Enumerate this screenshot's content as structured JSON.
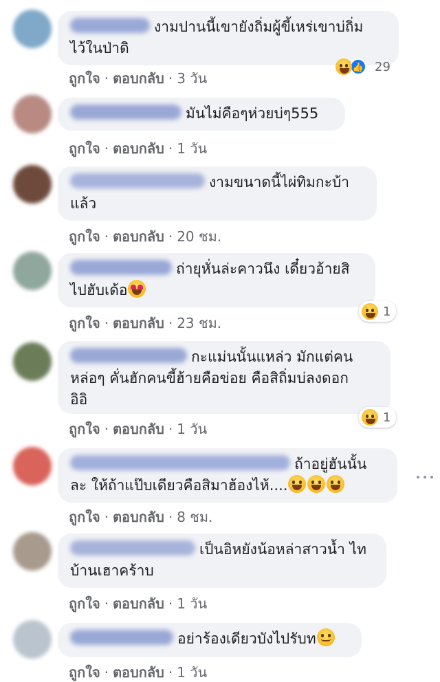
{
  "actions": {
    "like": "ถูกใจ",
    "reply": "ตอบกลับ",
    "sep": "·"
  },
  "comments": [
    {
      "text": "งามปานนี้เขายังถิ่มผู้ขี้เหร่เขาบ่ถิ่ม\nไว้ในป่าดิ",
      "time": "3 วัน",
      "reaction_count": "29",
      "avatar_color": "#7fa8c9"
    },
    {
      "text": "มันไม่คือๆห่วยบ่ๆ555",
      "time": "1 วัน",
      "avatar_color": "#b88a82"
    },
    {
      "text": "งามขนาดนี้ไผ่ทิมกะบ้า\nแล้ว",
      "time": "20 ชม.",
      "avatar_color": "#6e4a3c"
    },
    {
      "text": "ถ่ายุหั่นล่ะคาวนึง เดี๋ยวอ้ายสิ\nไปฮับเด้อ",
      "time": "23 ชม.",
      "reaction_count": "1",
      "avatar_color": "#8fa79c"
    },
    {
      "text": "กะแม่นนั้นแหล่ว มักแต่คน\nหล่อๆ คั่นฮักคนขี้ฮ้ายคือข่อย คือสิถิ่มบ่ลงดอก\nอิอิ",
      "time": "1 วัน",
      "reaction_count": "1",
      "avatar_color": "#6b7d58"
    },
    {
      "text": "ถ้าอยู่ฮันนั้น\nละ ให้ถ้าแป๊บเดียวคือสิมาฮ้องไห้....",
      "time": "8 ชม.",
      "avatar_color": "#d9645b"
    },
    {
      "text": "เป็นอิหยังน้อหล่าสาวน้ำ ไท\nบ้านเฮาคร้าบ",
      "time": "1 วัน",
      "avatar_color": "#a89a8c"
    },
    {
      "text": "อย่าร้องเดียวบังไปรับท",
      "time": "1 วัน",
      "avatar_color": "#b9c4cf"
    }
  ]
}
